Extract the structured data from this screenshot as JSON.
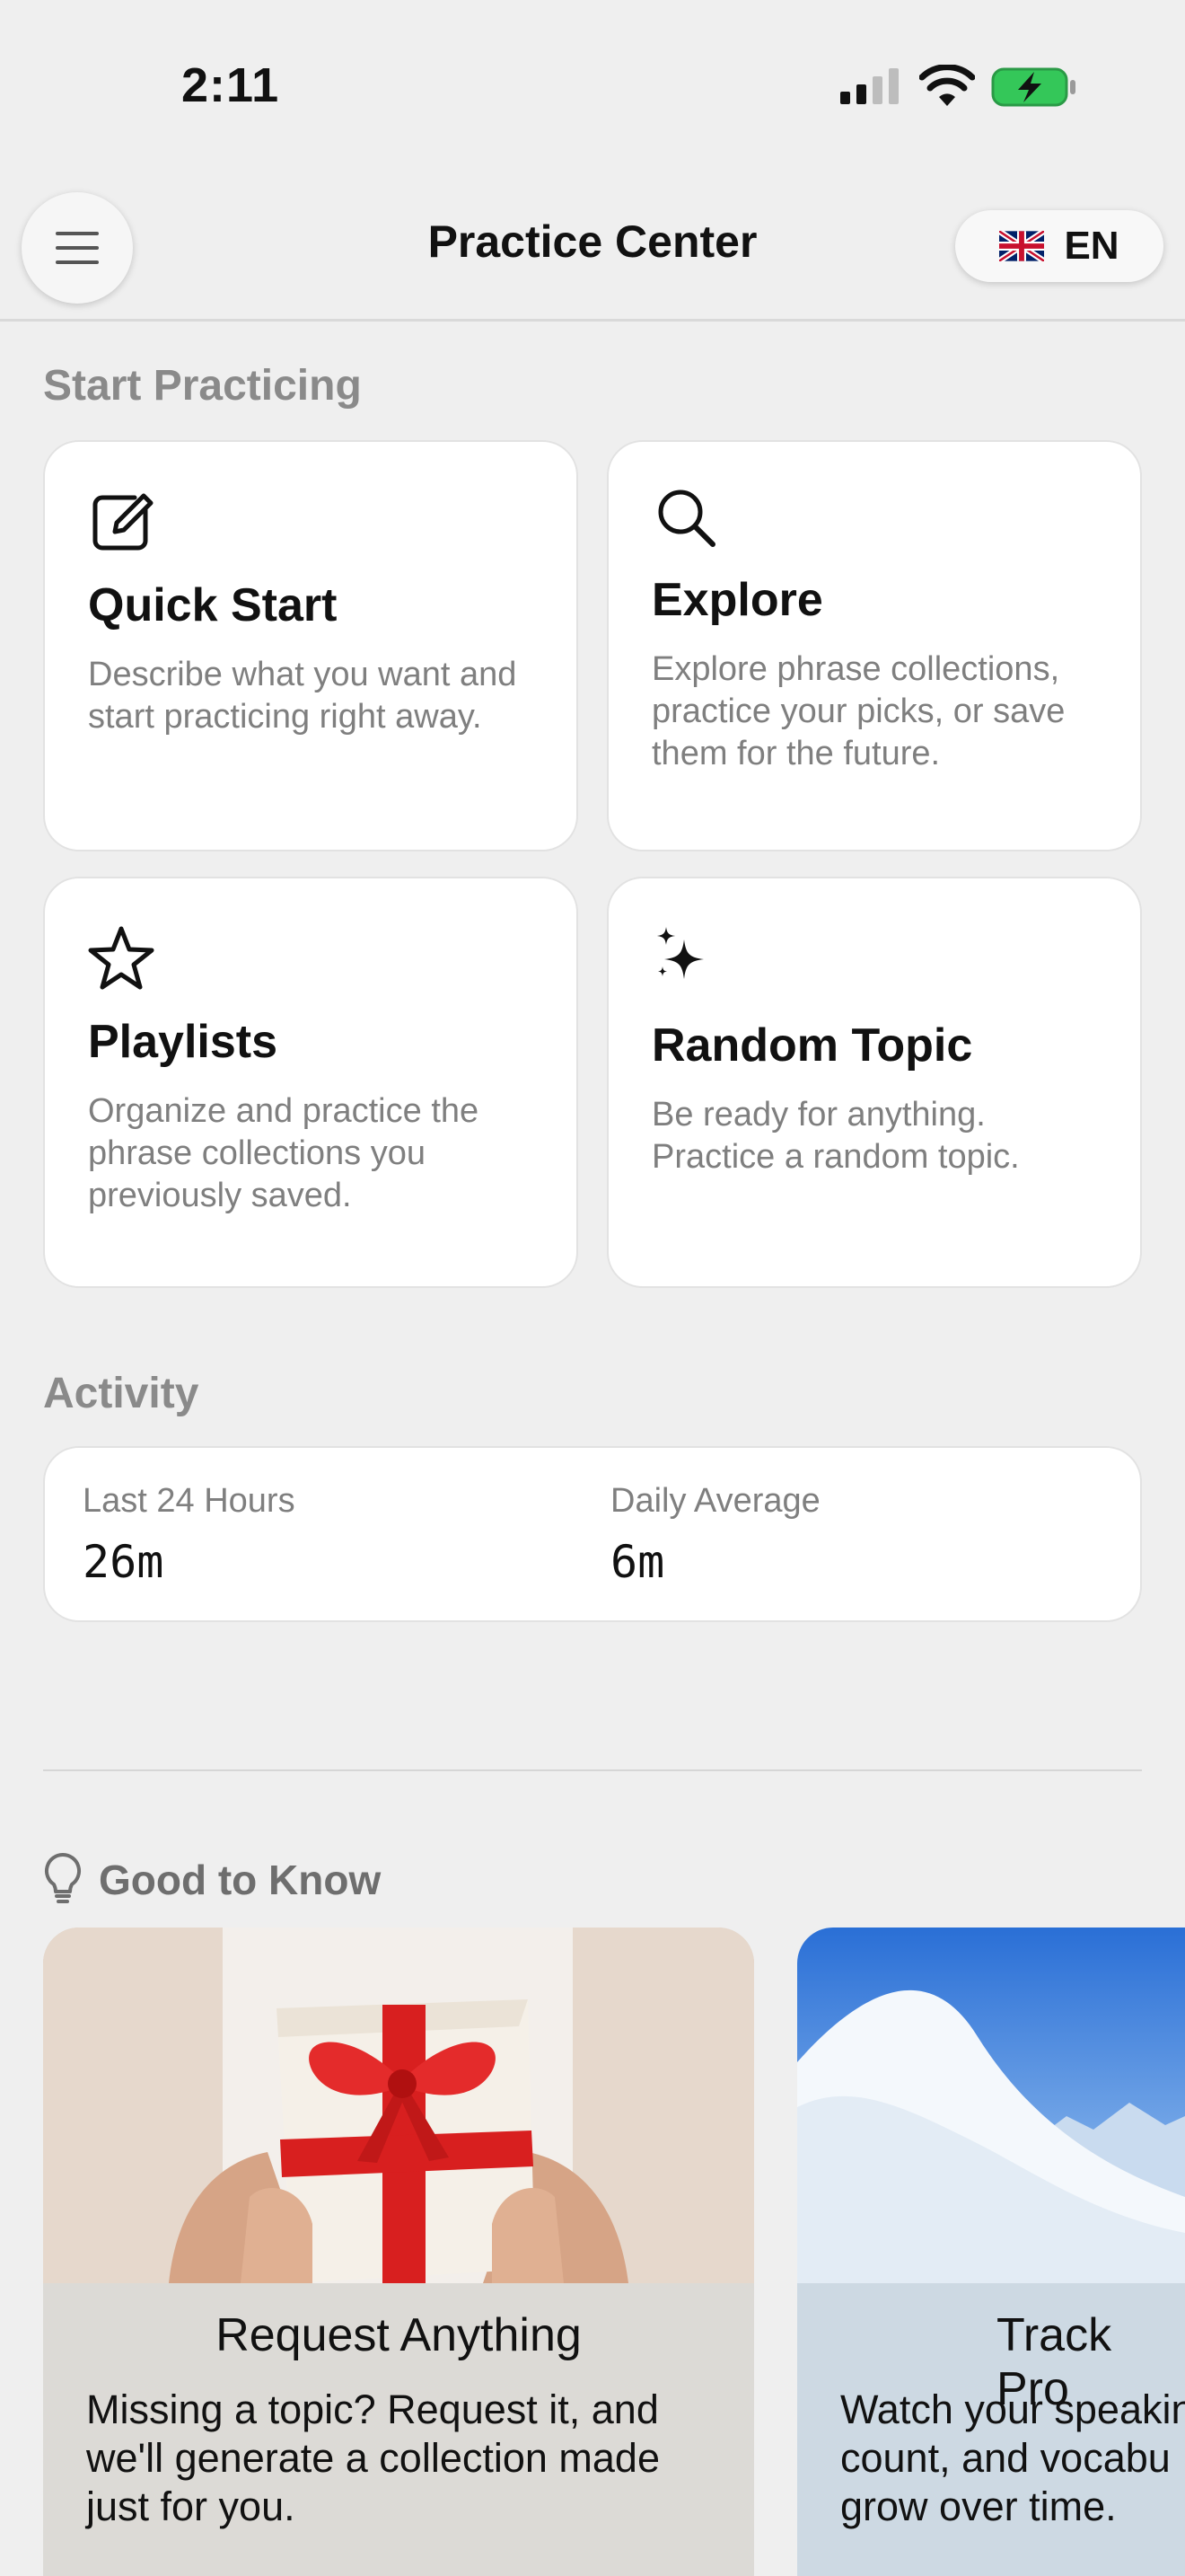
{
  "status_bar": {
    "time": "2:11",
    "signal_icon": "cellular-signal-icon",
    "wifi_icon": "wifi-icon",
    "battery_icon": "battery-charging-icon",
    "battery_color": "#34c759"
  },
  "header": {
    "menu_icon": "hamburger-menu-icon",
    "title": "Practice Center",
    "language": {
      "flag_icon": "uk-flag-icon",
      "label": "EN"
    }
  },
  "start_practicing": {
    "section_title": "Start Practicing",
    "cards": [
      {
        "icon": "compose-icon",
        "title": "Quick Start",
        "description": "Describe what you want and start practicing right away."
      },
      {
        "icon": "search-icon",
        "title": "Explore",
        "description": "Explore phrase collections, practice your picks, or save them for the future."
      },
      {
        "icon": "star-icon",
        "title": "Playlists",
        "description": "Organize and practice the phrase collections you previously saved."
      },
      {
        "icon": "sparkles-icon",
        "title": "Random Topic",
        "description": "Be ready for anything. Practice a random topic."
      }
    ]
  },
  "activity": {
    "section_title": "Activity",
    "stats": [
      {
        "label": "Last 24 Hours",
        "value": "26m"
      },
      {
        "label": "Daily Average",
        "value": "6m"
      }
    ]
  },
  "good_to_know": {
    "icon": "lightbulb-icon",
    "title": "Good to Know",
    "tips": [
      {
        "image": "gift-box-photo",
        "title": "Request Anything",
        "text_lines": [
          "Missing a topic? Request it, and",
          "we'll generate a collection made",
          "just for you."
        ]
      },
      {
        "image": "snowy-mountain-photo",
        "title": "Track Pro",
        "text_lines": [
          "Watch your speakin",
          "count, and vocabu",
          "grow over time."
        ]
      }
    ]
  }
}
